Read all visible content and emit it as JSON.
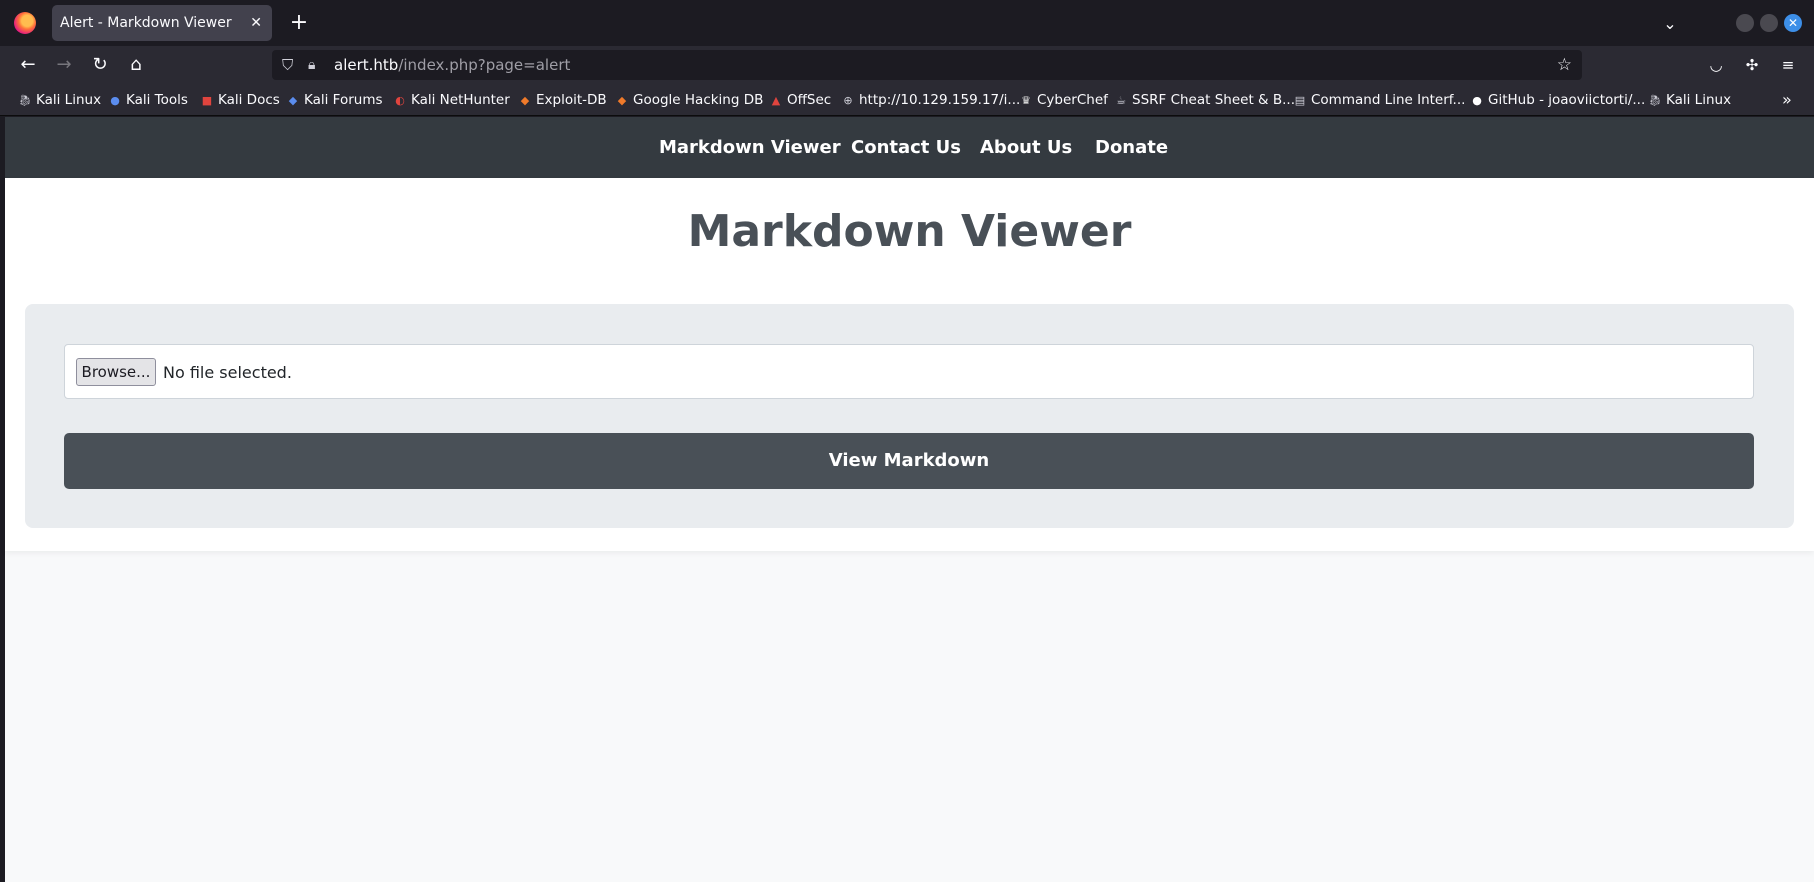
{
  "browser": {
    "tab_title": "Alert - Markdown Viewer",
    "tab_close": "✕",
    "new_tab": "+",
    "url_host": "alert.htb",
    "url_path": "/index.php?page=alert",
    "bookmarks": [
      {
        "label": "Kali Linux",
        "icon": "kali-dragon-icon"
      },
      {
        "label": "Kali Tools",
        "icon": "kali-tools-icon"
      },
      {
        "label": "Kali Docs",
        "icon": "kali-docs-icon"
      },
      {
        "label": "Kali Forums",
        "icon": "kali-forums-icon"
      },
      {
        "label": "Kali NetHunter",
        "icon": "nethunter-icon"
      },
      {
        "label": "Exploit-DB",
        "icon": "exploit-db-icon"
      },
      {
        "label": "Google Hacking DB",
        "icon": "ghdb-icon"
      },
      {
        "label": "OffSec",
        "icon": "offsec-icon"
      },
      {
        "label": "http://10.129.159.17/i...",
        "icon": "globe-icon"
      },
      {
        "label": "CyberChef",
        "icon": "cyberchef-icon"
      },
      {
        "label": "SSRF Cheat Sheet & B...",
        "icon": "ssrf-icon"
      },
      {
        "label": "Command Line Interf...",
        "icon": "document-icon"
      },
      {
        "label": "GitHub - joaoviictorti/...",
        "icon": "github-icon"
      },
      {
        "label": "Kali Linux",
        "icon": "kali-dragon-icon"
      }
    ]
  },
  "site": {
    "nav": [
      "Markdown Viewer",
      "Contact Us",
      "About Us",
      "Donate"
    ],
    "title": "Markdown Viewer",
    "browse_label": "Browse...",
    "file_status": "No file selected.",
    "submit_label": "View Markdown"
  },
  "colors": {
    "nav_bg": "#343a40",
    "title": "#495057",
    "button_bg": "#495057",
    "panel_bg": "#e9ecef"
  }
}
